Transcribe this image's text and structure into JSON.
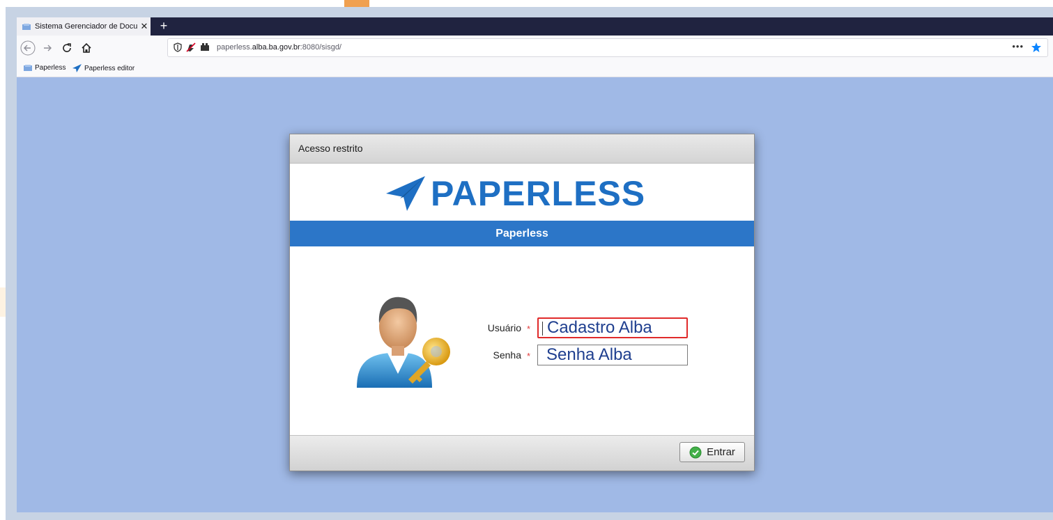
{
  "browser": {
    "tab_title": "Sistema Gerenciador de Docum",
    "tab_close": "✕",
    "new_tab": "+",
    "url_host": "paperless.",
    "url_domain": "alba.ba.gov.br",
    "url_rest": ":8080/sisgd/",
    "page_actions": "•••",
    "bookmarks": [
      "Paperless",
      "Paperless editor"
    ]
  },
  "dialog": {
    "title": "Acesso restrito",
    "logo_text": "PAPERLESS",
    "banner": "Paperless",
    "username_label": "Usuário",
    "username_value": "Cadastro Alba",
    "password_label": "Senha",
    "password_value": "Senha Alba",
    "required_mark": "*",
    "submit_label": "Entrar"
  },
  "colors": {
    "page_background": "#a0b9e6",
    "brand_blue": "#1e6fc3",
    "banner_blue": "#2c76c8",
    "focus_border": "#e02a2a"
  },
  "icons": [
    "back-arrow-icon",
    "forward-arrow-icon",
    "reload-icon",
    "home-icon",
    "shield-icon",
    "permissions-icon",
    "star-icon",
    "paper-plane-icon",
    "user-key-icon",
    "check-circle-icon"
  ]
}
